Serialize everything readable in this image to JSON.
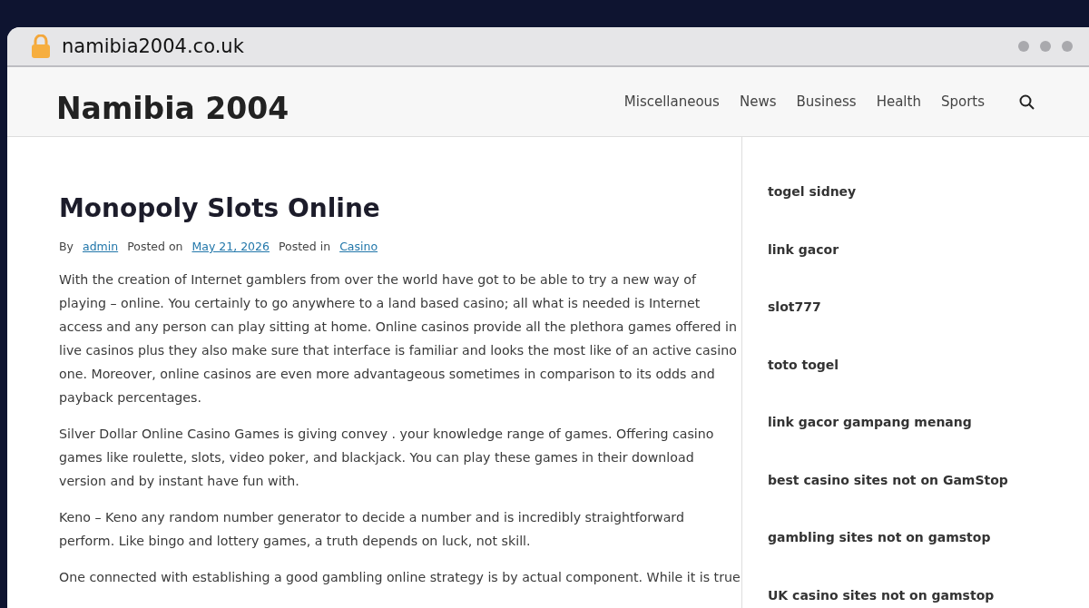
{
  "browser": {
    "url": "namibia2004.co.uk"
  },
  "site": {
    "title": "Namibia 2004",
    "nav": [
      {
        "label": "Miscellaneous"
      },
      {
        "label": "News"
      },
      {
        "label": "Business"
      },
      {
        "label": "Health"
      },
      {
        "label": "Sports"
      }
    ]
  },
  "post": {
    "title": "Monopoly Slots Online",
    "meta": [
      {
        "kind": "text",
        "text": "By"
      },
      {
        "kind": "link",
        "text": "admin"
      },
      {
        "kind": "text",
        "text": "Posted on"
      },
      {
        "kind": "link",
        "text": "May 21, 2026"
      },
      {
        "kind": "text",
        "text": "Posted in"
      },
      {
        "kind": "link",
        "text": "Casino"
      }
    ],
    "paragraphs": [
      "With the creation of Internet gamblers from over the world have got to be able to try a new way of playing – online. You certainly to go anywhere to a land based casino; all what is needed is Internet access and any person can play sitting at home. Online casinos provide all the plethora games offered in live casinos plus they also make sure that interface is familiar and looks the most like of an active casino one. Moreover, online casinos are even more advantageous sometimes in comparison to its odds and payback percentages.",
      "Silver Dollar Online Casino Games is giving convey . your knowledge range of games. Offering casino games like roulette, slots, video poker, and blackjack. You can play these games in their download version and by instant have fun with.",
      "Keno – Keno any random number generator to decide a number and is incredibly straightforward perform. Like bingo and lottery games, a truth depends on luck, not skill.",
      "One connected with establishing a good gambling online strategy is by actual component. While it is true"
    ]
  },
  "sidebar": {
    "links": [
      "togel sidney",
      "link gacor",
      "slot777",
      "toto togel",
      "link gacor gampang menang",
      "best casino sites not on GamStop",
      "gambling sites not on gamstop",
      "UK casino sites not on gamstop"
    ]
  }
}
